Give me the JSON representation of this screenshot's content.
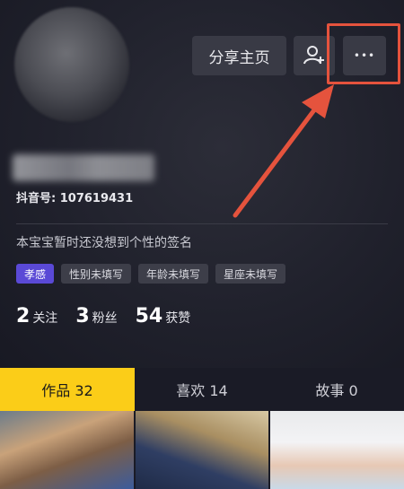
{
  "header": {
    "share_label": "分享主页",
    "follow_icon": "add-user-icon",
    "more_icon": "more-dots-icon",
    "more_glyph": "•••",
    "highlight_color": "#e5533d"
  },
  "profile": {
    "douyin_id": "抖音号: 107619431",
    "signature": "本宝宝暂时还没想到个性的签名",
    "tags": [
      "孝感",
      "性别未填写",
      "年龄未填写",
      "星座未填写"
    ]
  },
  "stats": {
    "following_count": "2",
    "following_label": "关注",
    "fans_count": "3",
    "fans_label": "粉丝",
    "likes_count": "54",
    "likes_label": "获赞"
  },
  "tabs": [
    {
      "label": "作品 32",
      "active": true
    },
    {
      "label": "喜欢 14",
      "active": false
    },
    {
      "label": "故事 0",
      "active": false
    }
  ],
  "colors": {
    "active_tab": "#fbcd18",
    "tag_primary": "#5a49d6",
    "background": "#1a1b26"
  }
}
